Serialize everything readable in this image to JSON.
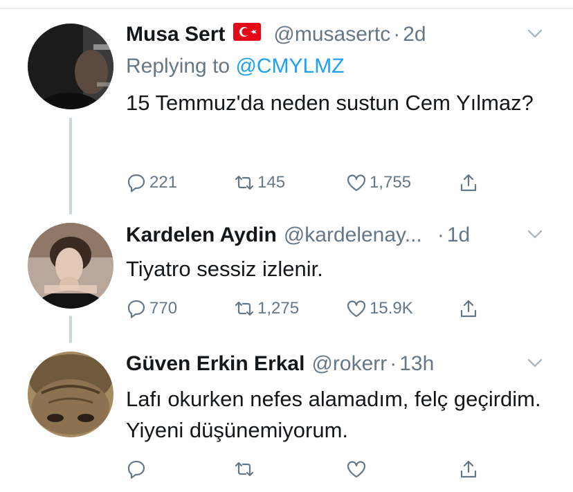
{
  "tweets": [
    {
      "name": "Musa Sert",
      "flag_icon": "turkey-flag-icon",
      "handle": "@musasertc",
      "separator": "·",
      "time": "2d",
      "reply_prefix": "Replying to",
      "reply_link": "@CMYLMZ",
      "text": "15 Temmuz'da neden sustun Cem Yılmaz?",
      "replies": "221",
      "retweets": "145",
      "likes": "1,755"
    },
    {
      "name": "Kardelen Aydin",
      "handle": "@kardelenay...",
      "separator": "·",
      "time": "1d",
      "text": "Tiyatro sessiz izlenir.",
      "replies": "770",
      "retweets": "1,275",
      "likes": "15.9K"
    },
    {
      "name": "Güven Erkin Erkal",
      "handle": "@rokerr",
      "separator": "·",
      "time": "13h",
      "text": "Lafı okurken nefes alamadım, felç geçirdim. Yiyeni düşünemiyorum.",
      "replies": "",
      "retweets": "",
      "likes": ""
    }
  ],
  "icons": {
    "reply": "reply-icon",
    "retweet": "retweet-icon",
    "like": "heart-icon",
    "share": "share-icon",
    "caret": "chevron-down-icon"
  },
  "colors": {
    "link": "#1da1f2",
    "secondary_text": "#657786",
    "thread_line": "#ccd6dd",
    "flag_red": "#e30a17"
  }
}
